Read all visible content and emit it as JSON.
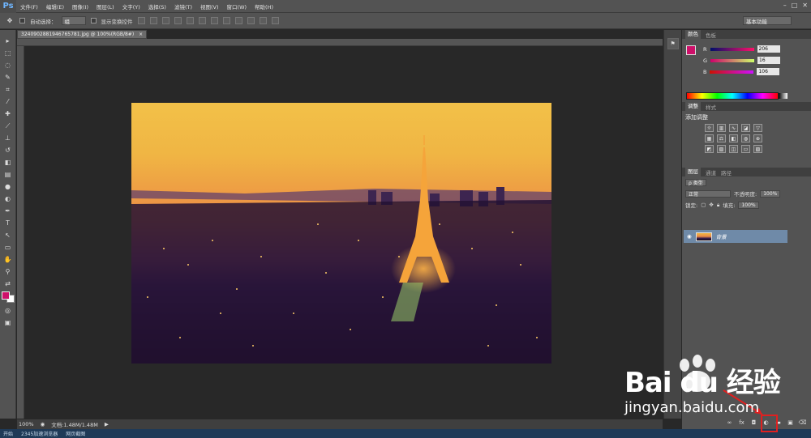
{
  "menubar": {
    "logo": "Ps",
    "items": [
      "文件(F)",
      "编辑(E)",
      "图像(I)",
      "图层(L)",
      "文字(Y)",
      "选择(S)",
      "滤镜(T)",
      "视图(V)",
      "窗口(W)",
      "帮助(H)"
    ],
    "window_controls": [
      "–",
      "□",
      "✕"
    ]
  },
  "options": {
    "auto_select_label": "自动选择：",
    "auto_select_value": "组",
    "show_transform_label": "显示变换控件",
    "workspace": "基本功能"
  },
  "document": {
    "tab_title": "324090288194676578​1.jpg @ 100%(RGB/8#)",
    "close": "×"
  },
  "status": {
    "zoom": "100%",
    "doc_info": "文档:1.48M/1.48M",
    "arrow": "▶"
  },
  "taskbar": {
    "items": [
      "开始",
      "2345加速浏览器",
      "网页截图"
    ]
  },
  "color_panel": {
    "tabs": [
      "颜色",
      "色板"
    ],
    "fg_color": "#ce106a",
    "bg_color": "#ffffff",
    "channels": [
      {
        "label": "R",
        "value": "206"
      },
      {
        "label": "G",
        "value": "16"
      },
      {
        "label": "B",
        "value": "106"
      }
    ]
  },
  "adjust_panel": {
    "tabs": [
      "调整",
      "样式"
    ],
    "title": "添加调整"
  },
  "layers_panel": {
    "tabs": [
      "图层",
      "通道",
      "路径"
    ],
    "filter": "ρ 类型",
    "blend_mode": "正常",
    "opacity_label": "不透明度:",
    "opacity_value": "100%",
    "lock_label": "锁定:",
    "fill_label": "填充:",
    "fill_value": "100%",
    "layer_name": "背景"
  },
  "watermark": {
    "brand": "Bai du 经验",
    "url": "jingyan.baidu.com"
  }
}
